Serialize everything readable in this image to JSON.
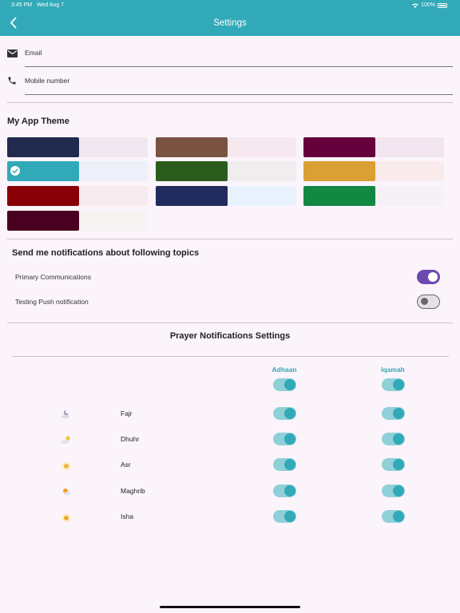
{
  "status_bar": {
    "time": "3:45 PM",
    "date": "Wed Aug 7",
    "battery": "100%"
  },
  "app_bar": {
    "title": "Settings",
    "back_icon": "chevron-left-icon"
  },
  "profile": {
    "email": {
      "label": "Email",
      "icon": "mail-icon"
    },
    "phone": {
      "label": "Mobile number",
      "icon": "phone-icon"
    }
  },
  "theme": {
    "title": "My App Theme",
    "swatches": [
      {
        "primary": "#222a4e",
        "secondary": "#efe8f1",
        "selected": false
      },
      {
        "primary": "#7b5343",
        "secondary": "#f5e8ef",
        "selected": false
      },
      {
        "primary": "#65003c",
        "secondary": "#f2e5ef",
        "selected": false
      },
      {
        "primary": "#31a9b8",
        "secondary": "#eef0f9",
        "selected": true
      },
      {
        "primary": "#2a5d1d",
        "secondary": "#efeded",
        "selected": false
      },
      {
        "primary": "#daa034",
        "secondary": "#f9ebec",
        "selected": false
      },
      {
        "primary": "#880005",
        "secondary": "#f8ebef",
        "selected": false
      },
      {
        "primary": "#222b5d",
        "secondary": "#e7f2fd",
        "selected": false
      },
      {
        "primary": "#138842",
        "secondary": "#f4f2f4",
        "selected": false
      },
      {
        "primary": "#4a0020",
        "secondary": "#f5f4f2",
        "selected": false
      }
    ]
  },
  "notifications": {
    "title": "Send me notifications about following topics",
    "topics": [
      {
        "label": "Primary Communications",
        "enabled": true
      },
      {
        "label": "Testing Push notification",
        "enabled": false
      }
    ]
  },
  "prayer": {
    "title": "Prayer Notifications Settings",
    "col_adhaan": "Adhaan",
    "col_iqamah": "Iqamah",
    "all_adhaan": true,
    "all_iqamah": true,
    "rows": [
      {
        "name": "Fajr",
        "icon": "moon-cloud-icon",
        "adhaan": true,
        "iqamah": true
      },
      {
        "name": "Dhuhr",
        "icon": "sun-cloud-icon",
        "adhaan": true,
        "iqamah": true
      },
      {
        "name": "Asr",
        "icon": "sun-icon",
        "adhaan": true,
        "iqamah": true
      },
      {
        "name": "Maghrib",
        "icon": "sunset-cloud-icon",
        "adhaan": true,
        "iqamah": true
      },
      {
        "name": "Isha",
        "icon": "sun-small-icon",
        "adhaan": true,
        "iqamah": true
      }
    ]
  },
  "colors": {
    "accent": "#31a9b8",
    "toggle_on": "#6c4ab0"
  }
}
